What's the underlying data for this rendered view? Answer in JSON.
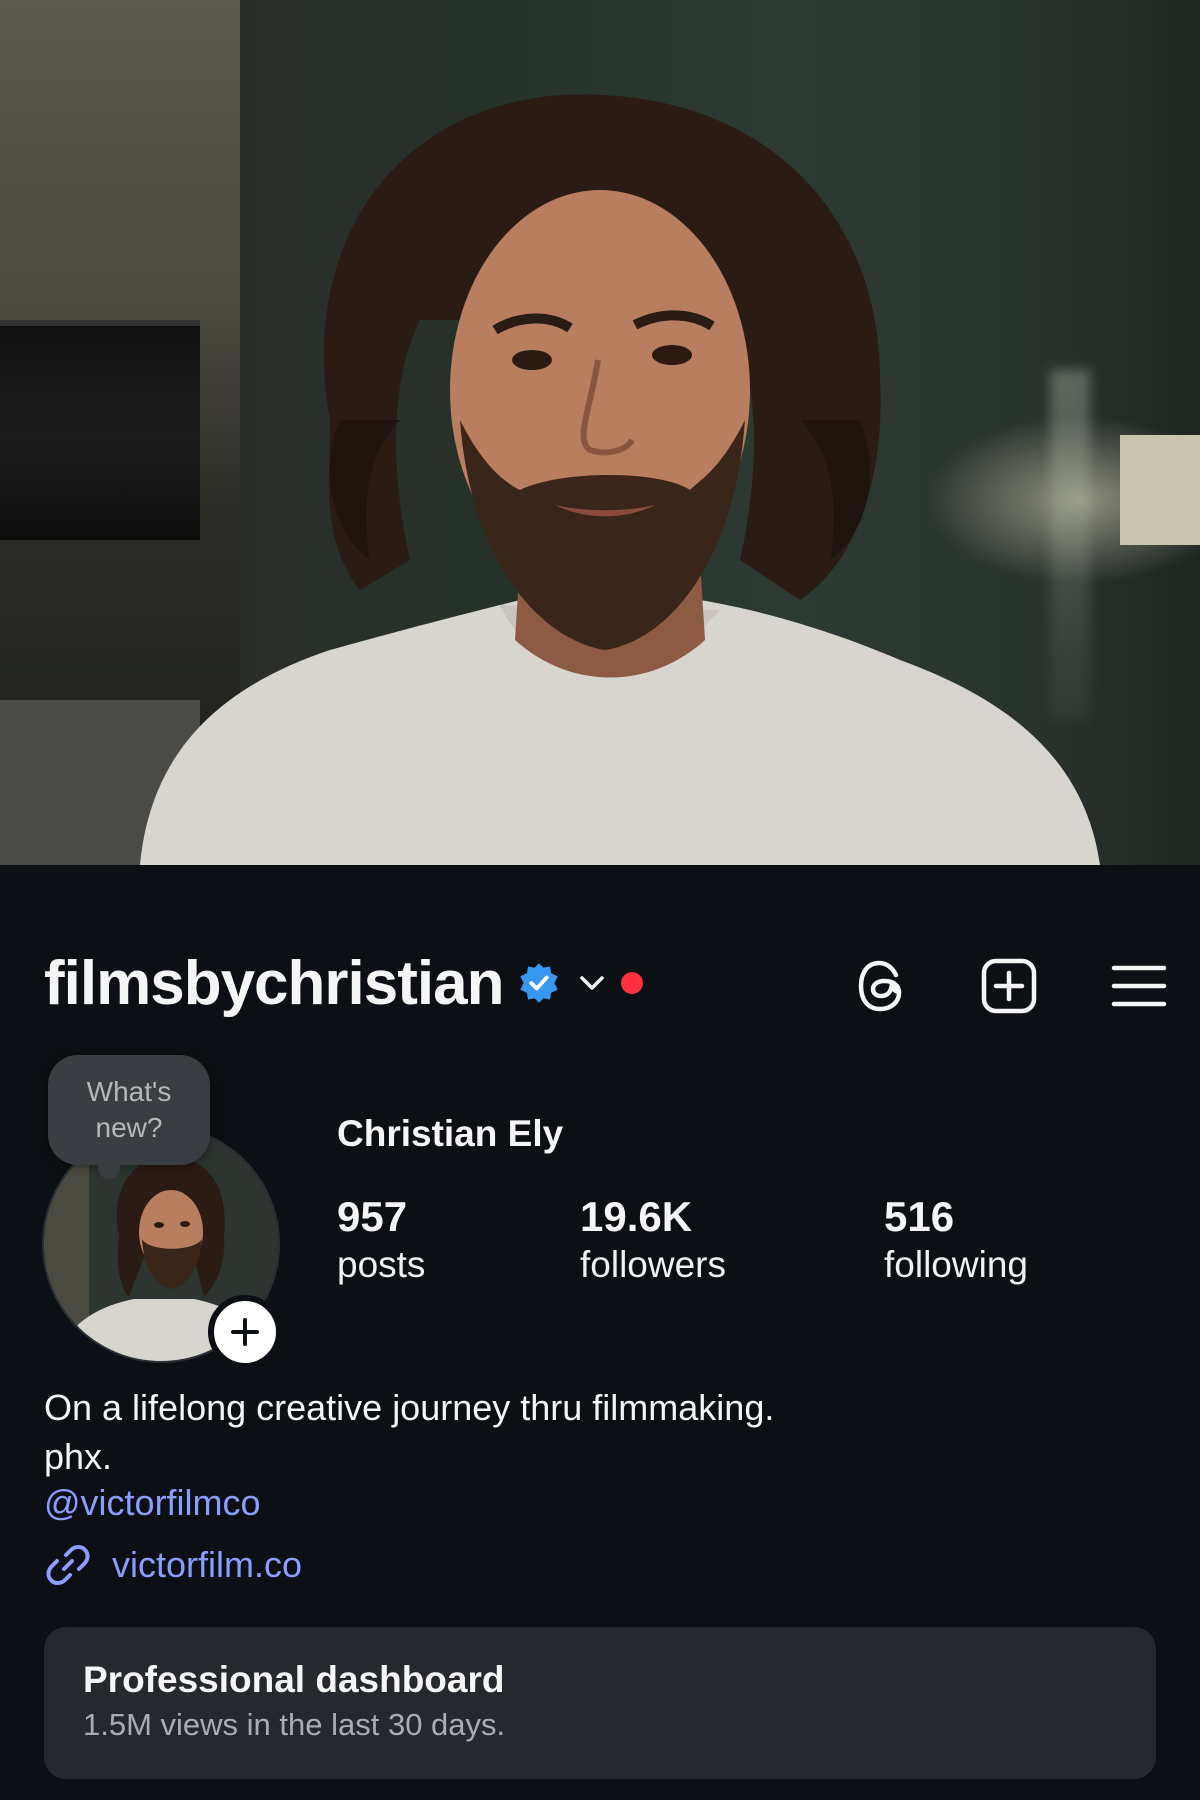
{
  "profile": {
    "username": "filmsbychristian",
    "display_name": "Christian Ely",
    "note_placeholder": "What's new?",
    "stats": {
      "posts_count": "957",
      "posts_label": "posts",
      "followers_count": "19.6K",
      "followers_label": "followers",
      "following_count": "516",
      "following_label": "following"
    },
    "bio_line1": "On a lifelong creative journey thru filmmaking.",
    "bio_line2": "phx.",
    "mention": "@victorfilmco",
    "link": "victorfilm.co"
  },
  "dashboard": {
    "title": "Professional dashboard",
    "subtitle": "1.5M views in the last 30 days."
  },
  "colors": {
    "background": "#0c1014",
    "link": "#8c9cff",
    "verified": "#3897f0",
    "notification_dot": "#ff2f40",
    "card": "#25292e"
  },
  "icons": [
    "verified-badge-icon",
    "chevron-down-icon",
    "threads-icon",
    "new-post-icon",
    "menu-icon",
    "plus-icon",
    "link-icon"
  ]
}
